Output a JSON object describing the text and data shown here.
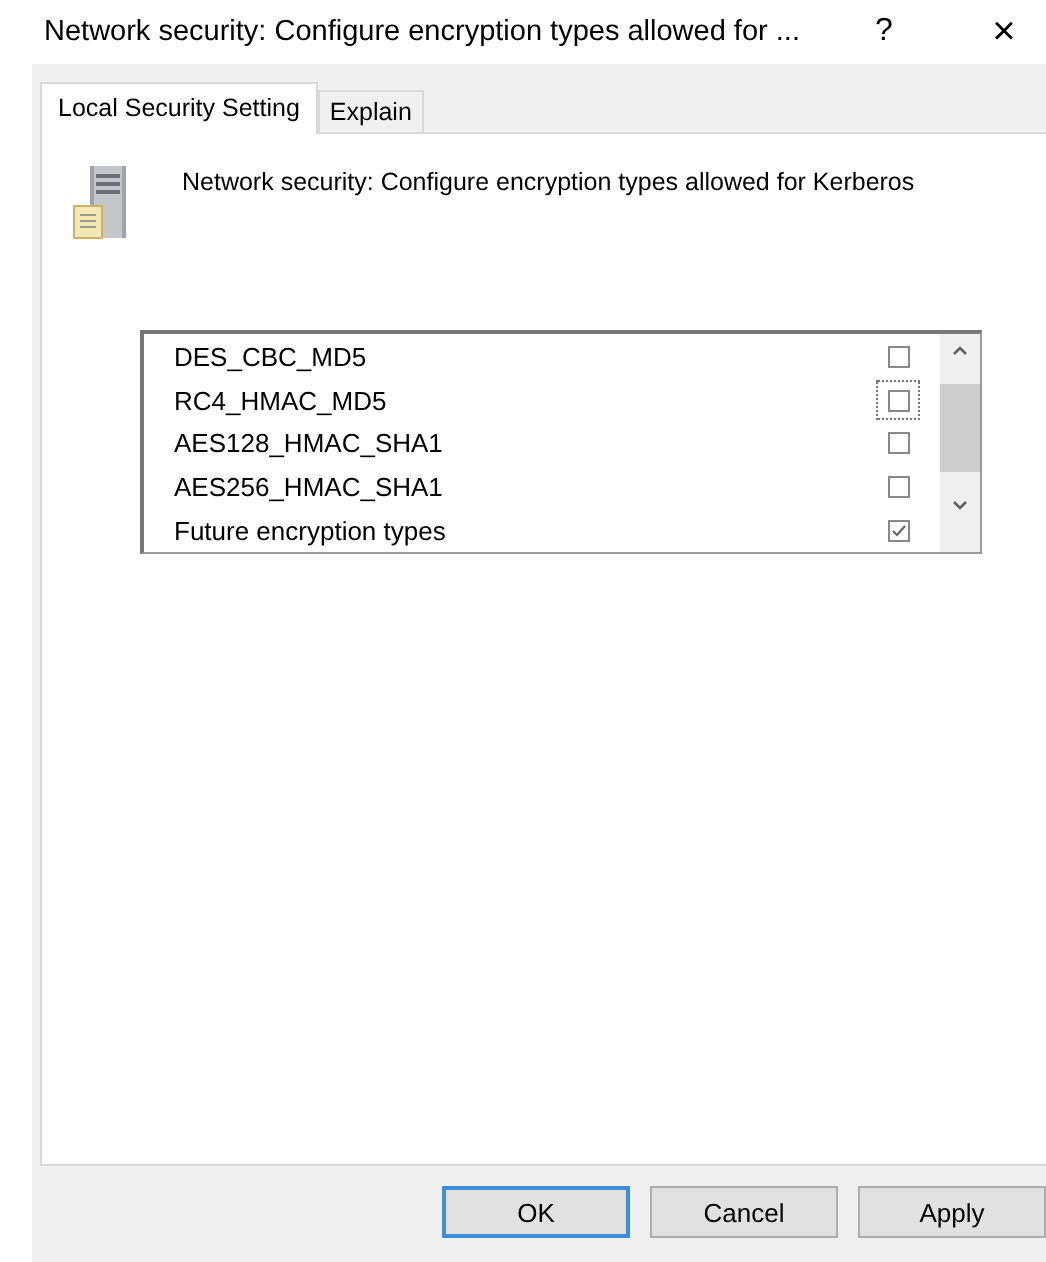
{
  "window": {
    "title": "Network security: Configure encryption types allowed for ...",
    "help": "?",
    "close": "×"
  },
  "tabs": [
    {
      "label": "Local Security Setting",
      "selected": true
    },
    {
      "label": "Explain",
      "selected": false
    }
  ],
  "policy": {
    "title": "Network security: Configure encryption types allowed for Kerberos"
  },
  "options": [
    {
      "label": "DES_CBC_MD5",
      "checked": false,
      "focused": false
    },
    {
      "label": "RC4_HMAC_MD5",
      "checked": false,
      "focused": true
    },
    {
      "label": "AES128_HMAC_SHA1",
      "checked": false,
      "focused": false
    },
    {
      "label": "AES256_HMAC_SHA1",
      "checked": false,
      "focused": false
    },
    {
      "label": "Future encryption types",
      "checked": true,
      "focused": false
    }
  ],
  "buttons": [
    {
      "label": "OK",
      "default": true
    },
    {
      "label": "Cancel",
      "default": false
    },
    {
      "label": "Apply",
      "default": false
    }
  ]
}
